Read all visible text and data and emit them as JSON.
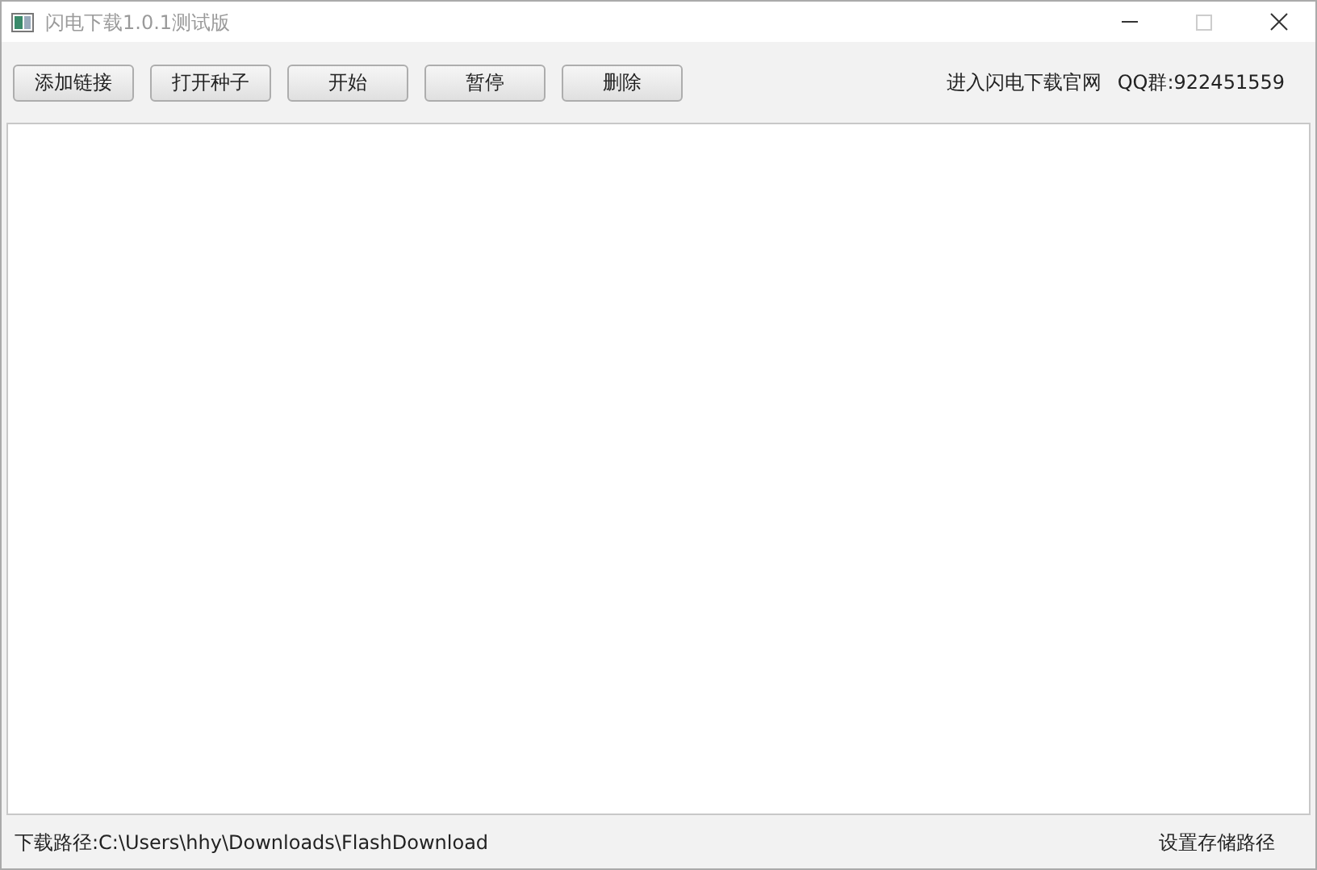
{
  "window": {
    "title": "闪电下载1.0.1测试版",
    "maximize_disabled": true
  },
  "toolbar": {
    "buttons": [
      "添加链接",
      "打开种子",
      "开始",
      "暂停",
      "删除"
    ],
    "links": [
      "进入闪电下载官网",
      "QQ群:922451559"
    ]
  },
  "status_bar": {
    "path": "下载路径:C:\\Users\\hhy\\Downloads\\FlashDownload",
    "action": "设置存储路径"
  }
}
